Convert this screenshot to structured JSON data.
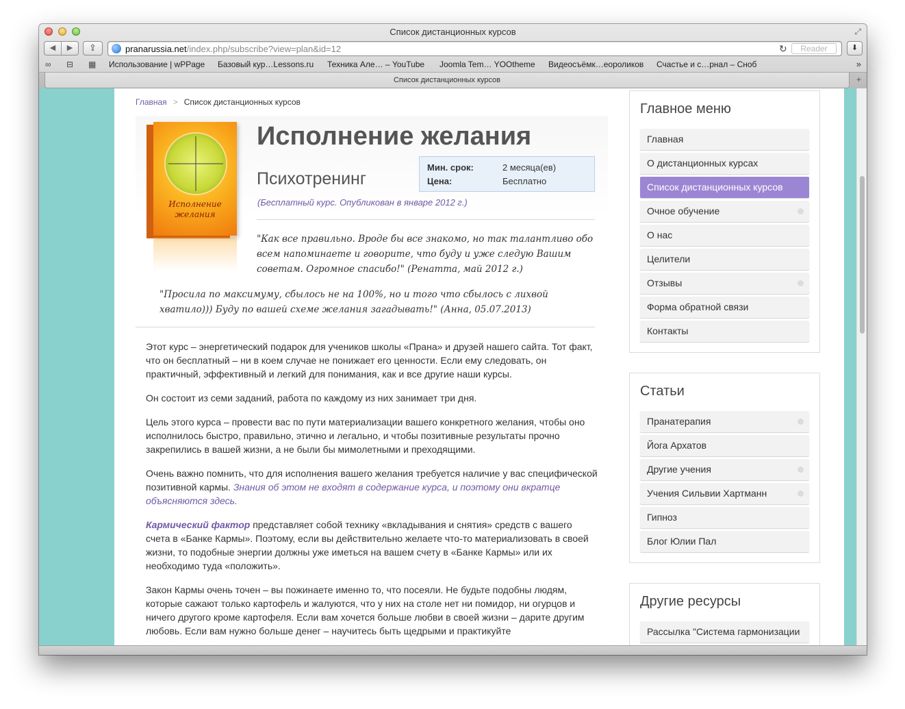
{
  "window": {
    "title": "Список дистанционных курсов"
  },
  "toolbar": {
    "url_host": "pranarussia.net",
    "url_path": "/index.php/subscribe?view=plan&id=12",
    "reader_label": "Reader"
  },
  "bookmarks": [
    "Использование | wPPage",
    "Базовый кур…Lessons.ru",
    "Техника Але… – YouTube",
    "Joomla Tem… YOOtheme",
    "Видеосъёмк…еороликов",
    "Счастье и с…рнал – Сноб"
  ],
  "tab": {
    "label": "Список дистанционных курсов"
  },
  "breadcrumb": {
    "home": "Главная",
    "current": "Список дистанционных курсов"
  },
  "product": {
    "box_title": "Исполнение желания",
    "title": "Исполнение желания",
    "subtitle": "Психотренинг",
    "min_term_label": "Мин. срок:",
    "min_term_value": "2 месяца(ев)",
    "price_label": "Цена:",
    "price_value": "Бесплатно",
    "published": "(Бесплатный курс. Опубликован в январе 2012 г.)",
    "quote1": "\"Как все правильно. Вроде бы все знакомо, но так талантливо обо всем напоминаете и говорите, что буду и уже следую Вашим советам. Огромное спасибо!\" (Ренатта, май 2012 г.)",
    "quote2": "\"Просила по максимуму, сбылось не на 100%, но и того что сбылось с лихвой хватило))) Буду по вашей схеме желания загадывать!\" (Анна, 05.07.2013)"
  },
  "body": {
    "p1": "Этот курс – энергетический подарок для учеников школы «Прана» и друзей нашего сайта. Тот факт, что он бесплатный – ни в коем случае не понижает его ценности. Если ему следовать, он практичный, эффективный и легкий для понимания, как и все другие наши курсы.",
    "p2": "Он состоит из семи заданий, работа по каждому из них занимает три дня.",
    "p3": "Цель этого курса – провести вас по пути материализации вашего конкретного желания, чтобы оно исполнилось быстро, правильно, этично и легально, и чтобы позитивные результаты прочно закрепились в вашей жизни, а не были бы мимолетными и преходящими.",
    "p4_text": "Очень важно помнить, что для исполнения вашего желания требуется наличие у вас специфической позитивной кармы.",
    "p4_link": "Знания об этом не входят в содержание курса, и поэтому они вкратце объясняются здесь.",
    "p5_link": "Кармический фактор",
    "p5_text": "представляет собой технику «вкладывания и снятия» средств с вашего счета в «Банке Кармы». Поэтому, если вы действительно желаете что-то материализовать в своей жизни, то подобные энергии должны уже иметься на вашем счету в «Банке Кармы» или их необходимо туда «положить».",
    "p6": "Закон Кармы очень точен – вы пожинаете именно то, что посеяли. Не будьте подобны людям, которые сажают только картофель и жалуются, что у них на столе нет ни помидор, ни огурцов и ничего другого кроме картофеля. Если вам хочется больше любви в своей жизни – дарите другим любовь. Если вам нужно больше денег – научитесь быть щедрыми и практикуйте"
  },
  "main_menu": {
    "title": "Главное меню",
    "items": [
      {
        "label": "Главная"
      },
      {
        "label": "О дистанционных курсах"
      },
      {
        "label": "Список дистанционных курсов"
      },
      {
        "label": "Очное обучение"
      },
      {
        "label": "О нас"
      },
      {
        "label": "Целители"
      },
      {
        "label": "Отзывы"
      },
      {
        "label": "Форма обратной связи"
      },
      {
        "label": "Контакты"
      }
    ]
  },
  "articles_menu": {
    "title": "Статьи",
    "items": [
      {
        "label": "Пранатерапия"
      },
      {
        "label": "Йога Архатов"
      },
      {
        "label": "Другие учения"
      },
      {
        "label": "Учения Сильвии Хартманн"
      },
      {
        "label": "Гипноз"
      },
      {
        "label": "Блог Юлии Пал"
      }
    ]
  },
  "resources_menu": {
    "title": "Другие ресурсы",
    "items": [
      {
        "label": "Рассылка \"Система гармонизации"
      }
    ]
  },
  "colors": {
    "page_background": "#88d1cd",
    "accent": "#9b86d4",
    "link": "#6f5aa6"
  }
}
